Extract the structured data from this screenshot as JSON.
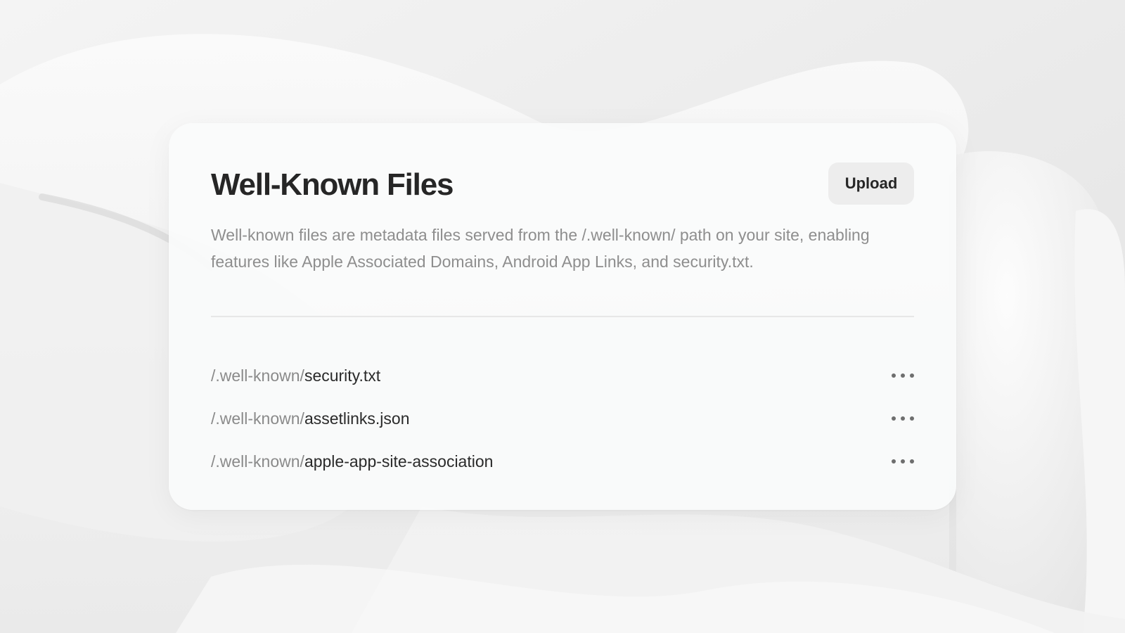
{
  "card": {
    "title": "Well-Known Files",
    "upload_label": "Upload",
    "description": "Well-known files are metadata files served from the /.well-known/ path on your site, enabling features like Apple Associated Domains, Android App Links, and security.txt."
  },
  "files": [
    {
      "prefix": "/.well-known/",
      "name": "security.txt",
      "action_icon": "more-horizontal-icon"
    },
    {
      "prefix": "/.well-known/",
      "name": "assetlinks.json",
      "action_icon": "more-horizontal-icon"
    },
    {
      "prefix": "/.well-known/",
      "name": "apple-app-site-association",
      "action_icon": "more-horizontal-icon"
    }
  ],
  "colors": {
    "background": "#ececec",
    "card": "#fafbfb",
    "title": "#262626",
    "muted_text": "#8e8e8e",
    "button_bg": "#ededed"
  }
}
